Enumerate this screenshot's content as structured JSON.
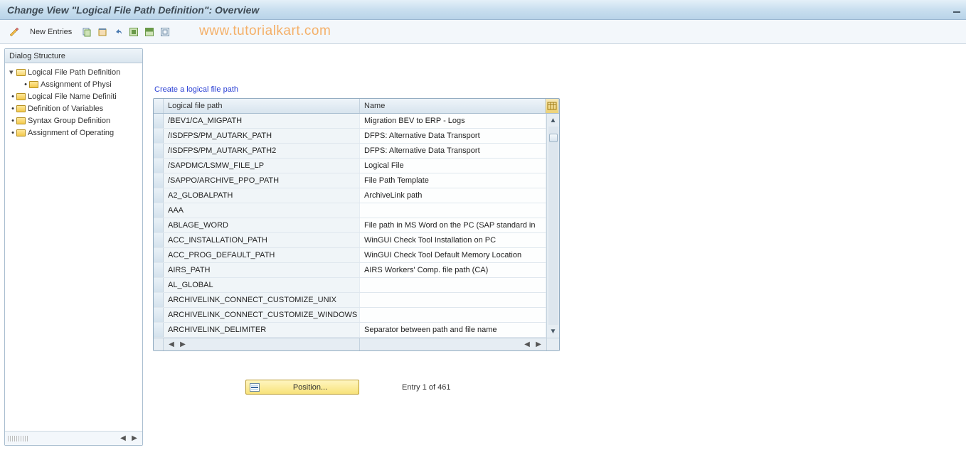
{
  "title": "Change View \"Logical File Path Definition\": Overview",
  "watermark": "www.tutorialkart.com",
  "toolbar": {
    "new_entries": "New Entries"
  },
  "tree": {
    "header": "Dialog Structure",
    "nodes": [
      {
        "label": "Logical File Path Definition",
        "level": 0,
        "open": true,
        "twisty": "▾"
      },
      {
        "label": "Assignment of Physi",
        "level": 1,
        "open": false,
        "twisty": "·"
      },
      {
        "label": "Logical File Name Definiti",
        "level": 0,
        "open": false,
        "twisty": "·"
      },
      {
        "label": "Definition of Variables",
        "level": 0,
        "open": false,
        "twisty": "·"
      },
      {
        "label": "Syntax Group Definition",
        "level": 0,
        "open": false,
        "twisty": "·"
      },
      {
        "label": "Assignment of Operating",
        "level": 0,
        "open": false,
        "twisty": "·"
      }
    ]
  },
  "section_title": "Create a logical file path",
  "table": {
    "columns": {
      "c1": "Logical file path",
      "c2": "Name"
    },
    "rows": [
      {
        "c1": "/BEV1/CA_MIGPATH",
        "c2": "Migration BEV to ERP - Logs"
      },
      {
        "c1": "/ISDFPS/PM_AUTARK_PATH",
        "c2": "DFPS: Alternative Data Transport"
      },
      {
        "c1": "/ISDFPS/PM_AUTARK_PATH2",
        "c2": "DFPS: Alternative Data Transport"
      },
      {
        "c1": "/SAPDMC/LSMW_FILE_LP",
        "c2": "Logical File"
      },
      {
        "c1": "/SAPPO/ARCHIVE_PPO_PATH",
        "c2": "File Path Template"
      },
      {
        "c1": "A2_GLOBALPATH",
        "c2": "ArchiveLink path"
      },
      {
        "c1": "AAA",
        "c2": ""
      },
      {
        "c1": "ABLAGE_WORD",
        "c2": "File path in MS Word on the PC (SAP standard in"
      },
      {
        "c1": "ACC_INSTALLATION_PATH",
        "c2": "WinGUI Check Tool Installation on PC"
      },
      {
        "c1": "ACC_PROG_DEFAULT_PATH",
        "c2": "WinGUI Check Tool Default Memory Location"
      },
      {
        "c1": "AIRS_PATH",
        "c2": "AIRS Workers' Comp. file path (CA)"
      },
      {
        "c1": "AL_GLOBAL",
        "c2": ""
      },
      {
        "c1": "ARCHIVELINK_CONNECT_CUSTOMIZE_UNIX",
        "c2": ""
      },
      {
        "c1": "ARCHIVELINK_CONNECT_CUSTOMIZE_WINDOWS",
        "c2": ""
      },
      {
        "c1": "ARCHIVELINK_DELIMITER",
        "c2": "Separator between path and file name"
      }
    ]
  },
  "position_button": "Position...",
  "entry_status": "Entry 1 of 461"
}
